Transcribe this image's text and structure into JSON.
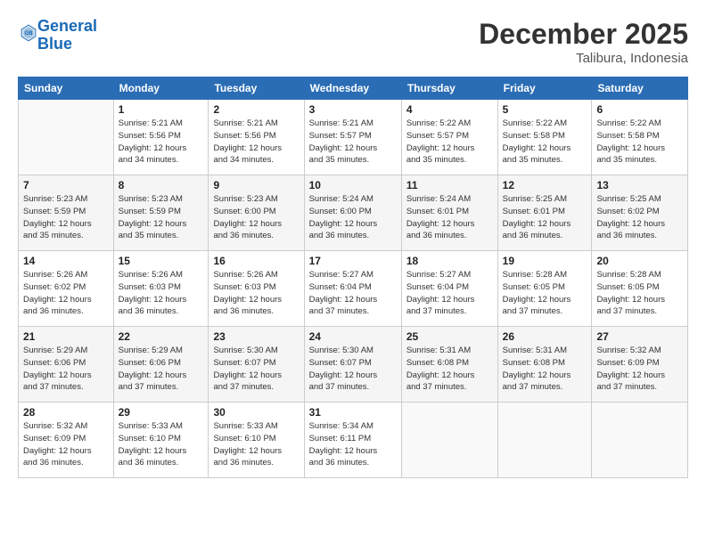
{
  "logo": {
    "line1": "General",
    "line2": "Blue"
  },
  "title": "December 2025",
  "subtitle": "Talibura, Indonesia",
  "header_days": [
    "Sunday",
    "Monday",
    "Tuesday",
    "Wednesday",
    "Thursday",
    "Friday",
    "Saturday"
  ],
  "weeks": [
    [
      {
        "day": "",
        "info": ""
      },
      {
        "day": "1",
        "info": "Sunrise: 5:21 AM\nSunset: 5:56 PM\nDaylight: 12 hours\nand 34 minutes."
      },
      {
        "day": "2",
        "info": "Sunrise: 5:21 AM\nSunset: 5:56 PM\nDaylight: 12 hours\nand 34 minutes."
      },
      {
        "day": "3",
        "info": "Sunrise: 5:21 AM\nSunset: 5:57 PM\nDaylight: 12 hours\nand 35 minutes."
      },
      {
        "day": "4",
        "info": "Sunrise: 5:22 AM\nSunset: 5:57 PM\nDaylight: 12 hours\nand 35 minutes."
      },
      {
        "day": "5",
        "info": "Sunrise: 5:22 AM\nSunset: 5:58 PM\nDaylight: 12 hours\nand 35 minutes."
      },
      {
        "day": "6",
        "info": "Sunrise: 5:22 AM\nSunset: 5:58 PM\nDaylight: 12 hours\nand 35 minutes."
      }
    ],
    [
      {
        "day": "7",
        "info": "Sunrise: 5:23 AM\nSunset: 5:59 PM\nDaylight: 12 hours\nand 35 minutes."
      },
      {
        "day": "8",
        "info": "Sunrise: 5:23 AM\nSunset: 5:59 PM\nDaylight: 12 hours\nand 35 minutes."
      },
      {
        "day": "9",
        "info": "Sunrise: 5:23 AM\nSunset: 6:00 PM\nDaylight: 12 hours\nand 36 minutes."
      },
      {
        "day": "10",
        "info": "Sunrise: 5:24 AM\nSunset: 6:00 PM\nDaylight: 12 hours\nand 36 minutes."
      },
      {
        "day": "11",
        "info": "Sunrise: 5:24 AM\nSunset: 6:01 PM\nDaylight: 12 hours\nand 36 minutes."
      },
      {
        "day": "12",
        "info": "Sunrise: 5:25 AM\nSunset: 6:01 PM\nDaylight: 12 hours\nand 36 minutes."
      },
      {
        "day": "13",
        "info": "Sunrise: 5:25 AM\nSunset: 6:02 PM\nDaylight: 12 hours\nand 36 minutes."
      }
    ],
    [
      {
        "day": "14",
        "info": "Sunrise: 5:26 AM\nSunset: 6:02 PM\nDaylight: 12 hours\nand 36 minutes."
      },
      {
        "day": "15",
        "info": "Sunrise: 5:26 AM\nSunset: 6:03 PM\nDaylight: 12 hours\nand 36 minutes."
      },
      {
        "day": "16",
        "info": "Sunrise: 5:26 AM\nSunset: 6:03 PM\nDaylight: 12 hours\nand 36 minutes."
      },
      {
        "day": "17",
        "info": "Sunrise: 5:27 AM\nSunset: 6:04 PM\nDaylight: 12 hours\nand 37 minutes."
      },
      {
        "day": "18",
        "info": "Sunrise: 5:27 AM\nSunset: 6:04 PM\nDaylight: 12 hours\nand 37 minutes."
      },
      {
        "day": "19",
        "info": "Sunrise: 5:28 AM\nSunset: 6:05 PM\nDaylight: 12 hours\nand 37 minutes."
      },
      {
        "day": "20",
        "info": "Sunrise: 5:28 AM\nSunset: 6:05 PM\nDaylight: 12 hours\nand 37 minutes."
      }
    ],
    [
      {
        "day": "21",
        "info": "Sunrise: 5:29 AM\nSunset: 6:06 PM\nDaylight: 12 hours\nand 37 minutes."
      },
      {
        "day": "22",
        "info": "Sunrise: 5:29 AM\nSunset: 6:06 PM\nDaylight: 12 hours\nand 37 minutes."
      },
      {
        "day": "23",
        "info": "Sunrise: 5:30 AM\nSunset: 6:07 PM\nDaylight: 12 hours\nand 37 minutes."
      },
      {
        "day": "24",
        "info": "Sunrise: 5:30 AM\nSunset: 6:07 PM\nDaylight: 12 hours\nand 37 minutes."
      },
      {
        "day": "25",
        "info": "Sunrise: 5:31 AM\nSunset: 6:08 PM\nDaylight: 12 hours\nand 37 minutes."
      },
      {
        "day": "26",
        "info": "Sunrise: 5:31 AM\nSunset: 6:08 PM\nDaylight: 12 hours\nand 37 minutes."
      },
      {
        "day": "27",
        "info": "Sunrise: 5:32 AM\nSunset: 6:09 PM\nDaylight: 12 hours\nand 37 minutes."
      }
    ],
    [
      {
        "day": "28",
        "info": "Sunrise: 5:32 AM\nSunset: 6:09 PM\nDaylight: 12 hours\nand 36 minutes."
      },
      {
        "day": "29",
        "info": "Sunrise: 5:33 AM\nSunset: 6:10 PM\nDaylight: 12 hours\nand 36 minutes."
      },
      {
        "day": "30",
        "info": "Sunrise: 5:33 AM\nSunset: 6:10 PM\nDaylight: 12 hours\nand 36 minutes."
      },
      {
        "day": "31",
        "info": "Sunrise: 5:34 AM\nSunset: 6:11 PM\nDaylight: 12 hours\nand 36 minutes."
      },
      {
        "day": "",
        "info": ""
      },
      {
        "day": "",
        "info": ""
      },
      {
        "day": "",
        "info": ""
      }
    ]
  ]
}
